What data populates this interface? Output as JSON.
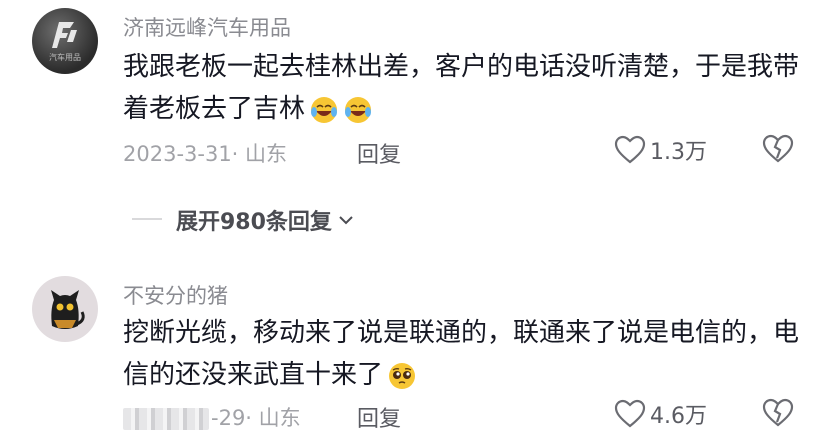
{
  "comments": [
    {
      "username": "济南远峰汽车用品",
      "avatar_text": "汽车用品",
      "text": "我跟老板一起去桂林出差，客户的电话没听清楚，于是我带着老板去了吉林",
      "emoji": "laughing-crying-emoji",
      "meta": "2023-3-31· 山东",
      "reply_label": "回复",
      "likes": "1.3万",
      "expand_label": "展开980条回复"
    },
    {
      "username": "不安分的猪",
      "text": "挖断光缆，移动来了说是联通的，联通来了说是电信的，电信的还没来武直十来了",
      "emoji": "pleading-face-emoji",
      "meta": "-29· 山东",
      "reply_label": "回复",
      "likes": "4.6万"
    }
  ],
  "colors": {
    "text": "#161823",
    "secondary": "#8a8b91",
    "meta": "#a1a2a7",
    "emoji_yellow": "#f7c634"
  }
}
